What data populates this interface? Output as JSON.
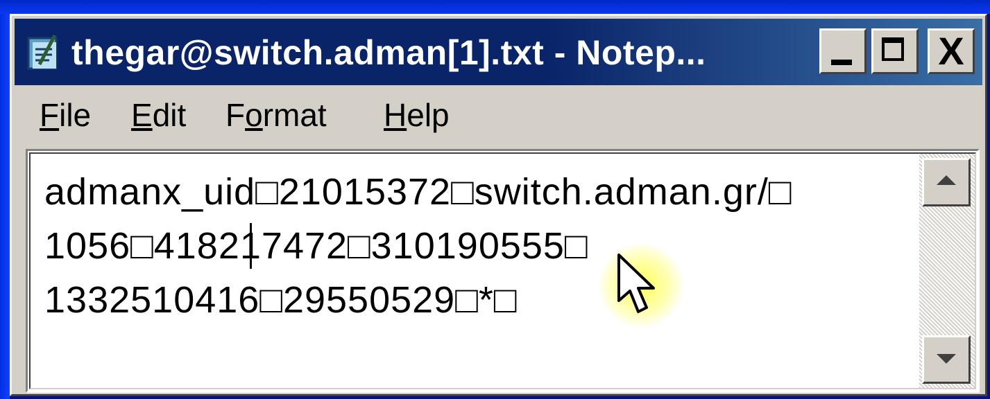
{
  "window": {
    "title": "thegar@switch.adman[1].txt - Notep...",
    "icon": "notepad-icon",
    "controls": {
      "minimize_icon": "minimize-icon",
      "maximize_icon": "maximize-icon",
      "close_label": "X"
    }
  },
  "menubar": {
    "items": [
      {
        "mnemonic": "F",
        "rest": "ile"
      },
      {
        "mnemonic": "E",
        "rest": "dit"
      },
      {
        "pre": "F",
        "mnemonic": "o",
        "rest": "rmat"
      },
      {
        "mnemonic": "H",
        "rest": "elp"
      }
    ]
  },
  "editor": {
    "lines": [
      "admanx_uid□21015372□switch.adman.gr/□",
      "1056□418217472□310190555□",
      "1332510416□29550529□*□"
    ]
  },
  "colors": {
    "titlebar": "#0a246a",
    "window_face": "#d4d0c8",
    "background": "#0a1080"
  }
}
